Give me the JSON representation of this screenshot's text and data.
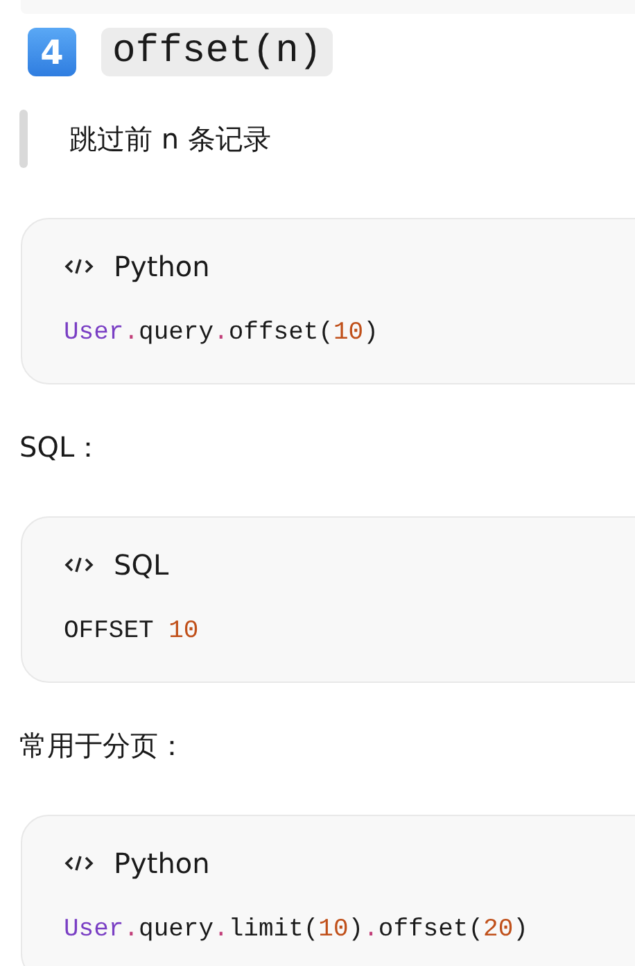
{
  "heading": {
    "badge": "4",
    "code": "offset(n)"
  },
  "quote": "跳过前 n 条记录",
  "sections": [
    {
      "kind": "code",
      "language": "Python",
      "lines": [
        [
          {
            "kind": "class",
            "text": "User"
          },
          {
            "kind": "punct",
            "text": "."
          },
          {
            "kind": "plain",
            "text": "query"
          },
          {
            "kind": "punct",
            "text": "."
          },
          {
            "kind": "plain",
            "text": "offset("
          },
          {
            "kind": "number",
            "text": "10"
          },
          {
            "kind": "plain",
            "text": ")"
          }
        ]
      ]
    },
    {
      "kind": "text",
      "text": "SQL："
    },
    {
      "kind": "code",
      "language": "SQL",
      "lines": [
        [
          {
            "kind": "plain",
            "text": "OFFSET "
          },
          {
            "kind": "number",
            "text": "10"
          }
        ]
      ]
    },
    {
      "kind": "text",
      "text": "常用于分页："
    },
    {
      "kind": "code",
      "language": "Python",
      "lines": [
        [
          {
            "kind": "class",
            "text": "User"
          },
          {
            "kind": "punct",
            "text": "."
          },
          {
            "kind": "plain",
            "text": "query"
          },
          {
            "kind": "punct",
            "text": "."
          },
          {
            "kind": "plain",
            "text": "limit("
          },
          {
            "kind": "number",
            "text": "10"
          },
          {
            "kind": "plain",
            "text": ")"
          },
          {
            "kind": "punct",
            "text": "."
          },
          {
            "kind": "plain",
            "text": "offset("
          },
          {
            "kind": "number",
            "text": "20"
          },
          {
            "kind": "plain",
            "text": ")"
          }
        ]
      ]
    }
  ]
}
